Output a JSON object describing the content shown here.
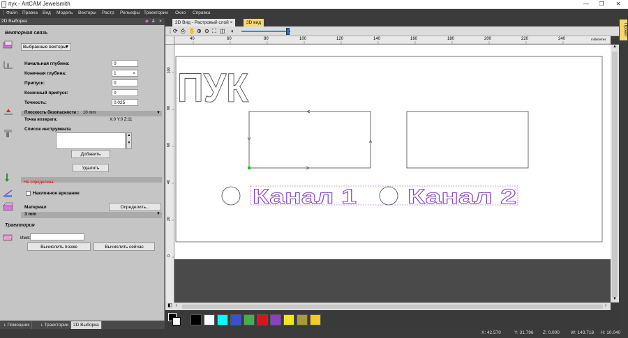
{
  "app": {
    "title": "пук - ArtCAM Jewelsmith"
  },
  "window_controls": {
    "minimize": "—",
    "restore": "❐",
    "close": "✕"
  },
  "menu": [
    "Файл",
    "Правка",
    "Вид",
    "Модель",
    "Векторы",
    "Растр",
    "Рельефы",
    "Траектории",
    "Окно",
    "Справка"
  ],
  "panel": {
    "title": "2D Выборка",
    "section_vector": "Векторная связь",
    "vector_select": "Выбранные векторы",
    "fields": [
      {
        "label": "Начальная глубина:",
        "value": "0"
      },
      {
        "label": "Конечная глубина:",
        "value": "1"
      },
      {
        "label": "Припуск:",
        "value": "0"
      },
      {
        "label": "Конечный припуск:",
        "value": "0"
      },
      {
        "label": "Точность:",
        "value": "0.025"
      }
    ],
    "safe_plane_label": "Плоскость безопасности :",
    "safe_plane_value": "10 mm",
    "return_point_label": "Точка возврата:",
    "return_point_value": "X:0 Y:0 Z:11",
    "tool_list_label": "Список инструмента",
    "add_button": "Добавить",
    "delete_button": "Удалить",
    "undefined_text": "Не определена",
    "ramp_label": "Наклонное врезание",
    "material_label": "Материал",
    "define_button": "Определить...",
    "material_value": "3 mm",
    "section_toolpath": "Траектория",
    "name_label": "Имя:",
    "name_value": "",
    "calc_later": "Вычислить позже",
    "calc_now": "Вычислить сейчас"
  },
  "bottom_tabs": [
    "Помощник",
    "Траектории",
    "2D Выборка"
  ],
  "doc_tabs": [
    "2D Вид - Растровый слой",
    "3D вид"
  ],
  "ruler_h": [
    "40",
    "60",
    "80",
    "100",
    "120",
    "140",
    "160",
    "180",
    "200",
    "220",
    "240"
  ],
  "ruler_v": [
    "100",
    "80",
    "60",
    "40",
    "20",
    "0"
  ],
  "ruler_unit": "millimetres",
  "canvas": {
    "text_main": "ПУК",
    "text_channel1": "Канал 1",
    "text_channel2": "Канал 2"
  },
  "palette": [
    "#000000",
    "#ffffff",
    "#00ffff",
    "#3a4fd6",
    "#3fb04a",
    "#d8141c",
    "#8e3fc8",
    "#f2e61a",
    "#a89a3c",
    "#f7c81e"
  ],
  "right_strip": "Проект",
  "status": {
    "x": "X: 42.570",
    "y": "Y: 31.796",
    "z": "Z: 0.000",
    "w": "W: 143.718",
    "h": "H: 10.040"
  }
}
